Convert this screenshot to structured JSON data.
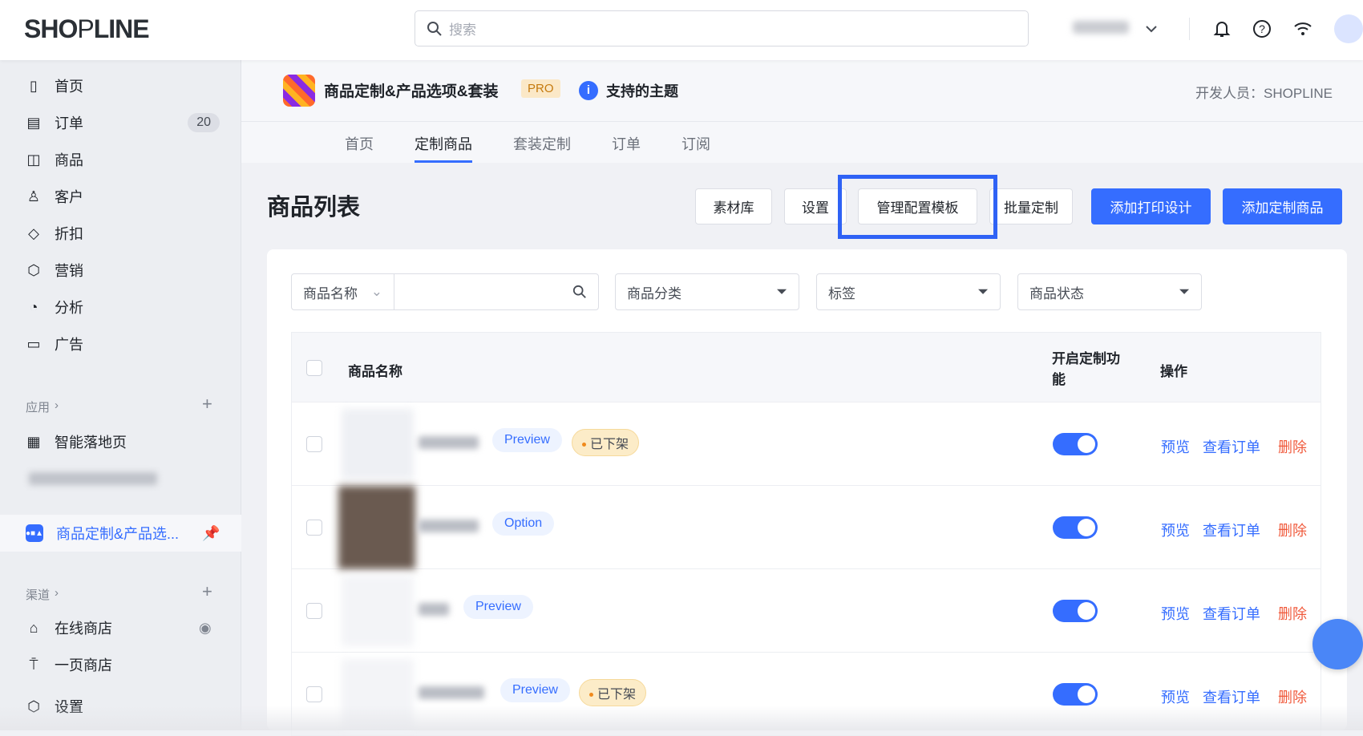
{
  "topbar": {
    "logo": "SHOPLINE",
    "search_placeholder": "搜索"
  },
  "sidebar": {
    "items": [
      {
        "label": "首页"
      },
      {
        "label": "订单",
        "badge": "20"
      },
      {
        "label": "商品"
      },
      {
        "label": "客户"
      },
      {
        "label": "折扣"
      },
      {
        "label": "营销"
      },
      {
        "label": "分析"
      },
      {
        "label": "广告"
      }
    ],
    "apps_section": "应用",
    "apps": [
      {
        "label": "智能落地页"
      },
      {
        "label": "商品定制&产品选..."
      }
    ],
    "channels_section": "渠道",
    "channels": [
      {
        "label": "在线商店"
      },
      {
        "label": "一页商店"
      }
    ],
    "settings": "设置"
  },
  "app": {
    "title": "商品定制&产品选项&套装",
    "pro": "PRO",
    "themes": "支持的主题",
    "developer": "开发人员：SHOPLINE"
  },
  "tabs": [
    "首页",
    "定制商品",
    "套装定制",
    "订单",
    "订阅"
  ],
  "page": {
    "title": "商品列表"
  },
  "buttons": {
    "materials": "素材库",
    "settings": "设置",
    "templates": "管理配置模板",
    "batch": "批量定制",
    "add_print": "添加打印设计",
    "add_product": "添加定制商品"
  },
  "filters": {
    "name_select": "商品名称",
    "category": "商品分类",
    "tags": "标签",
    "status": "商品状态"
  },
  "table": {
    "headers": {
      "name": "商品名称",
      "enable": "开启定制功能",
      "actions": "操作"
    },
    "rows": [
      {
        "tag": "Preview",
        "status": "已下架",
        "enabled": true
      },
      {
        "tag": "Option",
        "status": "",
        "enabled": true
      },
      {
        "tag": "Preview",
        "status": "",
        "enabled": true
      },
      {
        "tag": "Preview",
        "status": "已下架",
        "enabled": true
      }
    ],
    "actions": {
      "preview": "预览",
      "orders": "查看订单",
      "delete": "删除"
    }
  },
  "colors": {
    "accent": "#356dff",
    "danger": "#f05a3c",
    "highlight": "#2f62f5"
  }
}
